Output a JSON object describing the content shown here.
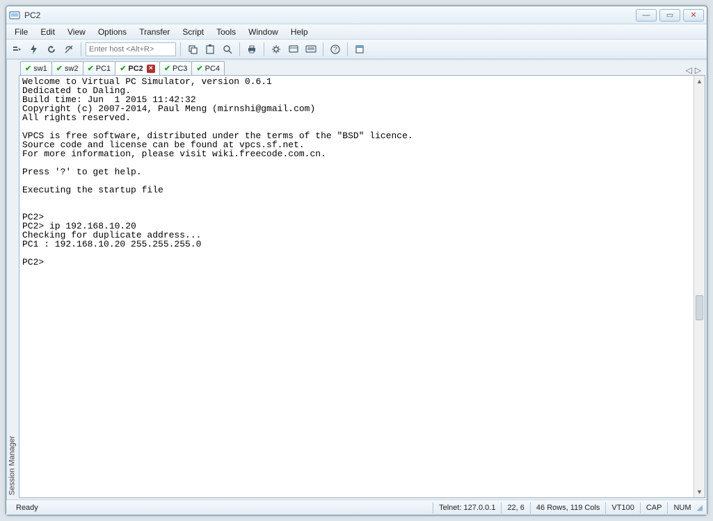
{
  "titlebar": {
    "title": "PC2"
  },
  "menu": {
    "items": [
      "File",
      "Edit",
      "View",
      "Options",
      "Transfer",
      "Script",
      "Tools",
      "Window",
      "Help"
    ]
  },
  "toolbar": {
    "host_placeholder": "Enter host <Alt+R>"
  },
  "sidebar": {
    "label": "Session Manager"
  },
  "tabs": [
    {
      "label": "sw1",
      "check": true,
      "close": false,
      "active": false
    },
    {
      "label": "sw2",
      "check": true,
      "close": false,
      "active": false
    },
    {
      "label": "PC1",
      "check": true,
      "close": false,
      "active": false
    },
    {
      "label": "PC2",
      "check": true,
      "close": true,
      "active": true
    },
    {
      "label": "PC3",
      "check": true,
      "close": false,
      "active": false
    },
    {
      "label": "PC4",
      "check": true,
      "close": false,
      "active": false
    }
  ],
  "tabnav": {
    "left": "◁",
    "right": "▷"
  },
  "terminal_text": "Welcome to Virtual PC Simulator, version 0.6.1\nDedicated to Daling.\nBuild time: Jun  1 2015 11:42:32\nCopyright (c) 2007-2014, Paul Meng (mirnshi@gmail.com)\nAll rights reserved.\n\nVPCS is free software, distributed under the terms of the \"BSD\" licence.\nSource code and license can be found at vpcs.sf.net.\nFor more information, please visit wiki.freecode.com.cn.\n\nPress '?' to get help.\n\nExecuting the startup file\n\n\nPC2>\nPC2> ip 192.168.10.20\nChecking for duplicate address...\nPC1 : 192.168.10.20 255.255.255.0\n\nPC2>",
  "status": {
    "ready": "Ready",
    "telnet": "Telnet: 127.0.0.1",
    "pos": "22,   6",
    "size": "46 Rows, 119 Cols",
    "term": "VT100",
    "cap": "CAP",
    "num": "NUM"
  }
}
